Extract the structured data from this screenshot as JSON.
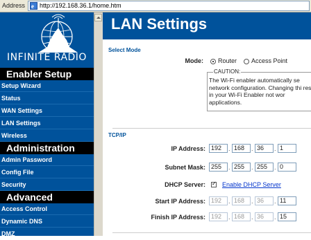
{
  "browser": {
    "address_label": "Address",
    "url": "http://192.168.36.1/home.htm"
  },
  "sidebar": {
    "logo": "INFINITE RADIO",
    "sections": [
      {
        "title": "Enabler Setup",
        "items": [
          "Setup Wizard",
          "Status",
          "WAN Settings",
          "LAN Settings",
          "Wireless"
        ]
      },
      {
        "title": "Administration",
        "items": [
          "Admin Password",
          "Config File",
          "Security"
        ]
      },
      {
        "title": "Advanced",
        "items": [
          "Access Control",
          "Dynamic DNS",
          "DMZ"
        ]
      }
    ]
  },
  "page": {
    "title": "LAN Settings",
    "select_mode": {
      "heading": "Select Mode",
      "label": "Mode:",
      "options": [
        "Router",
        "Access Point"
      ],
      "selected": "Router"
    },
    "caution": {
      "title": "CAUTION:",
      "text": "The Wi-Fi enabler automatically se network configuration. Changing thi result in your Wi-Fi Enabler not wor applications."
    },
    "tcpip": {
      "heading": "TCP/IP",
      "ip_label": "IP Address:",
      "ip": [
        "192",
        "168",
        "36",
        "1"
      ],
      "mask_label": "Subnet Mask:",
      "mask": [
        "255",
        "255",
        "255",
        "0"
      ],
      "dhcp_label": "DHCP Server:",
      "dhcp_link": "Enable DHCP Server",
      "start_label": "Start IP Address:",
      "start_ip": [
        "192",
        "168",
        "36",
        "11"
      ],
      "finish_label": "Finish IP Address:",
      "finish_ip": [
        "192",
        "168",
        "36",
        "15"
      ]
    }
  },
  "colors": {
    "brand_blue": "#00529b",
    "section_black": "#000000",
    "link_blue": "#0033cc"
  }
}
